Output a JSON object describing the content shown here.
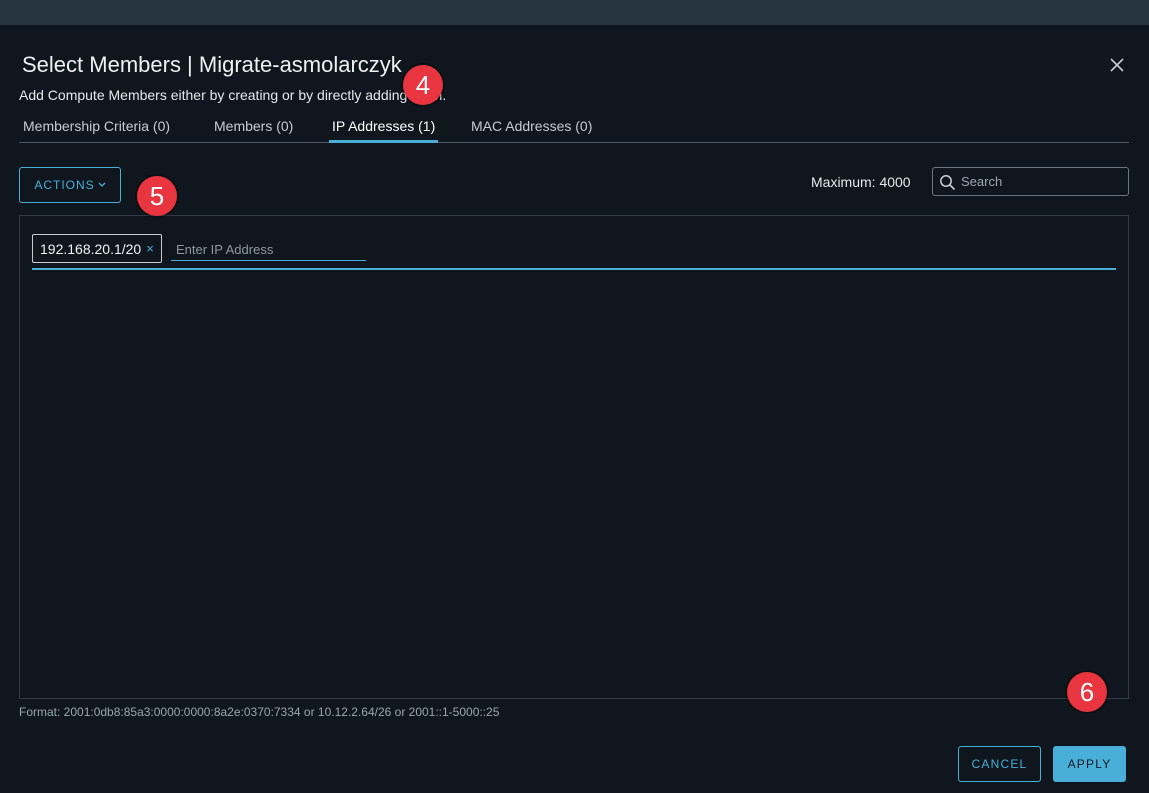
{
  "modal": {
    "title": "Select Members | Migrate-asmolarczyk",
    "subtitle": "Add Compute Members either by creating or by directly adding them."
  },
  "tabs": [
    {
      "label": "Membership Criteria (0)",
      "active": false
    },
    {
      "label": "Members (0)",
      "active": false
    },
    {
      "label": "IP Addresses (1)",
      "active": true
    },
    {
      "label": "MAC Addresses (0)",
      "active": false
    }
  ],
  "toolbar": {
    "actions_label": "ACTIONS",
    "maximum_label": "Maximum: 4000",
    "search_placeholder": "Search"
  },
  "ip_panel": {
    "chips": [
      "192.168.20.1/20"
    ],
    "chip_remove_glyph": "×",
    "input_placeholder": "Enter IP Address",
    "format_hint": "Format: 2001:0db8:85a3:0000:0000:8a2e:0370:7334 or 10.12.2.64/26 or 2001::1-5000::25"
  },
  "footer": {
    "cancel_label": "CANCEL",
    "apply_label": "APPLY"
  },
  "annotations": [
    "4",
    "5",
    "6"
  ],
  "icons": {
    "close": "close-icon",
    "search": "search-icon",
    "actions_caret": "chevron-down-icon"
  },
  "colors": {
    "accent": "#49afd9",
    "background": "#0f161d",
    "badge": "#e8353f"
  }
}
